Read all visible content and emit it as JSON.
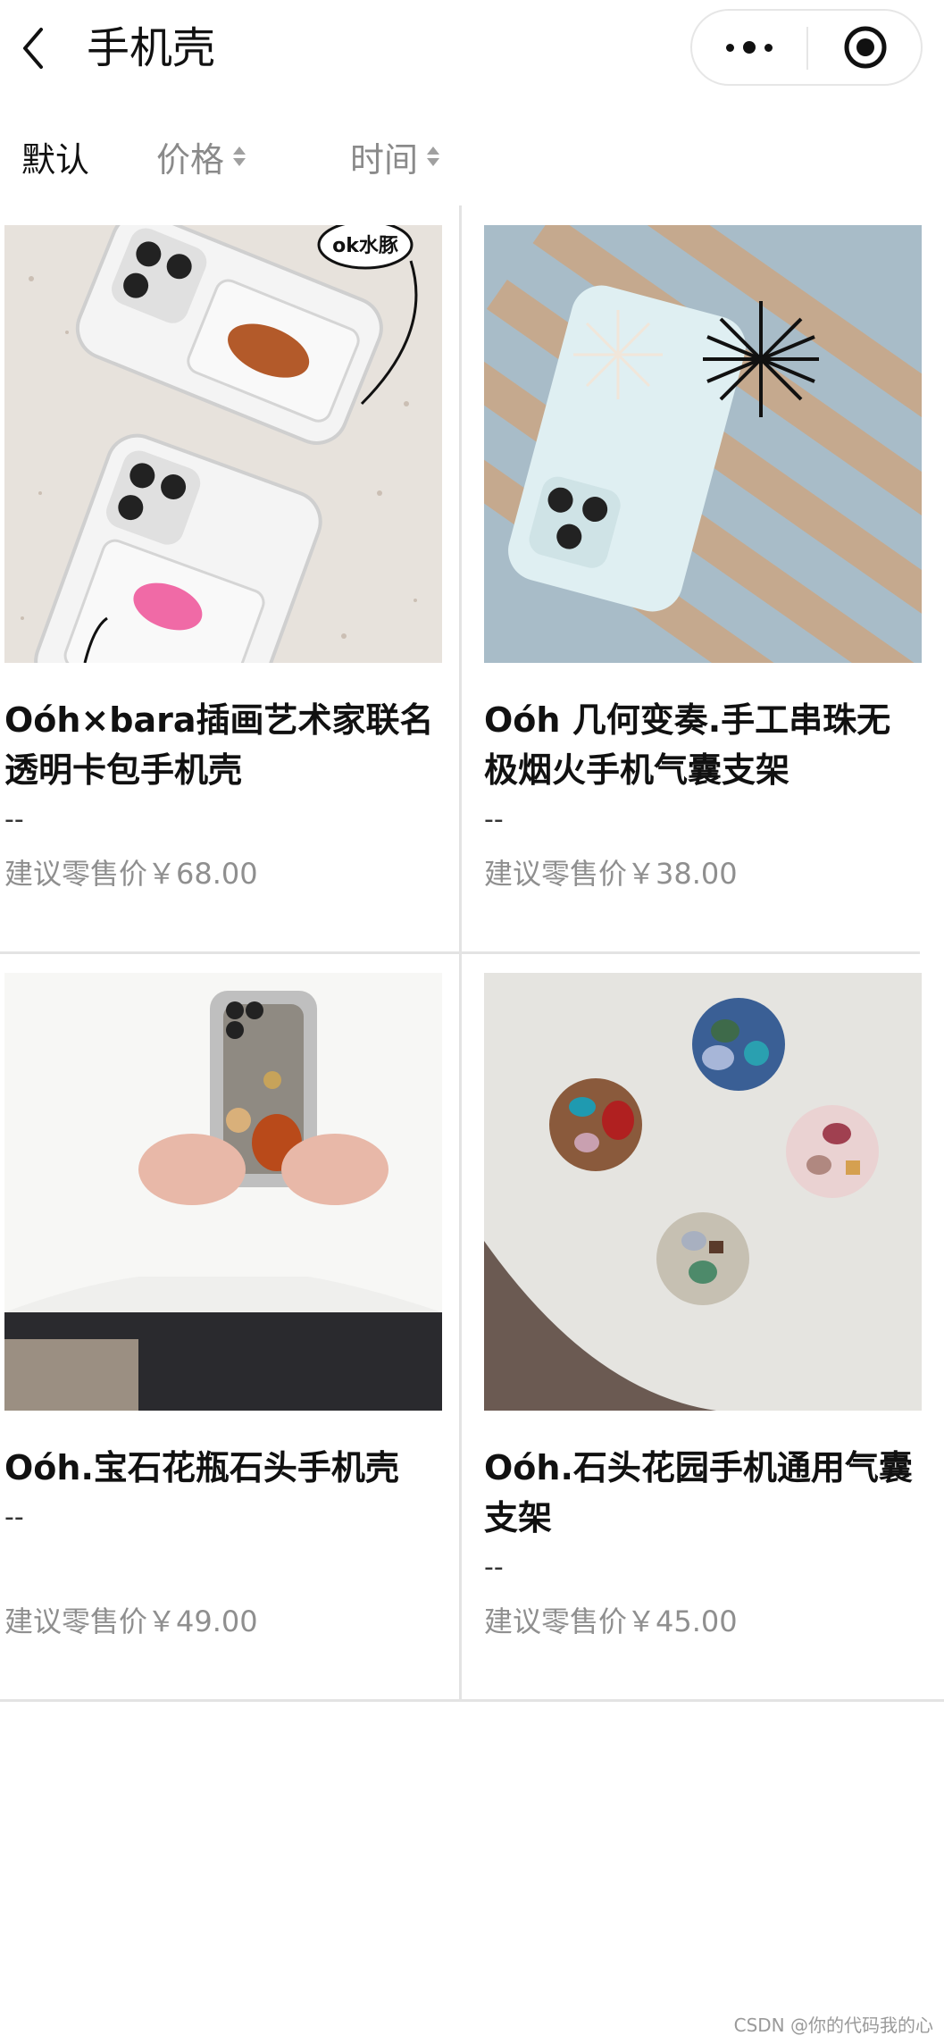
{
  "navbar": {
    "title": "手机壳",
    "back_icon": "chevron-left-icon",
    "more_icon": "more-dots-icon",
    "close_icon": "target-icon"
  },
  "sort": {
    "default_label": "默认",
    "price_label": "价格",
    "time_label": "时间"
  },
  "products": [
    {
      "title": "Oóh×bara插画艺术家联名透明卡包手机壳",
      "subtitle": "--",
      "price_label": "建议零售价",
      "price": "￥68.00",
      "image_caption": "ok水豚"
    },
    {
      "title": "Oóh 几何变奏.手工串珠无极烟火手机气囊支架",
      "subtitle": "--",
      "price_label": "建议零售价",
      "price": "￥38.00"
    },
    {
      "title": "Oóh.宝石花瓶石头手机壳",
      "subtitle": "--",
      "price_label": "建议零售价",
      "price": "￥49.00"
    },
    {
      "title": "Oóh.石头花园手机通用气囊支架",
      "subtitle": "--",
      "price_label": "建议零售价",
      "price": "￥45.00"
    }
  ],
  "watermark": "CSDN @你的代码我的心"
}
